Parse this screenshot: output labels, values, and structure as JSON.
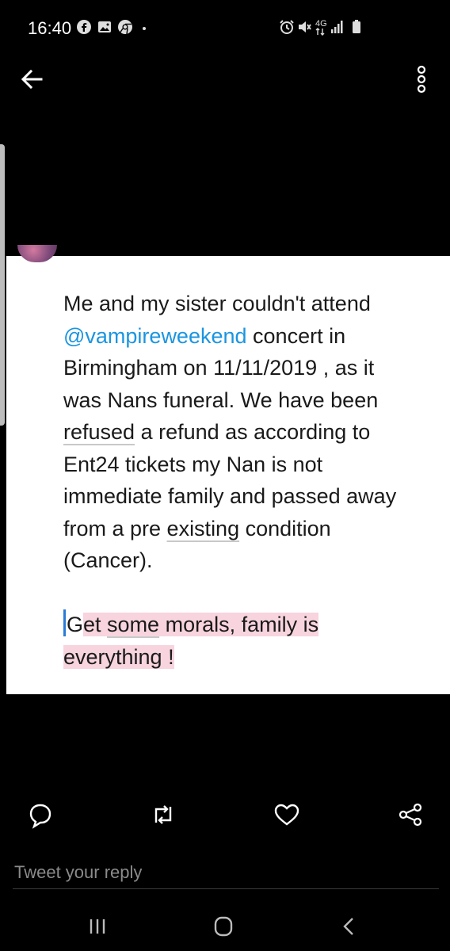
{
  "status_bar": {
    "time": "16:40",
    "network": "4G",
    "left_icons": [
      "facebook-icon",
      "gallery-icon",
      "chrome-icon"
    ],
    "right_icons": [
      "alarm-icon",
      "mute-icon",
      "4g-icon",
      "signal-icon",
      "battery-icon"
    ]
  },
  "top_bar": {
    "back_icon": "arrow-left-icon",
    "menu_icon": "more-vertical-icon"
  },
  "tweet": {
    "line1": "Me and my sister couldn't attend",
    "mention": "@vampireweekend",
    "line2_rest": " concert in",
    "line3": "Birmingham on 11/11/2019 , as it",
    "line4": "was Nans funeral. We have been",
    "word_refused": "refused",
    "line5_rest": " a refund as according to",
    "line6": "Ent24 tickets my Nan is not",
    "line7": "immediate family and passed away",
    "line8_start": "from a pre ",
    "word_existing": "existing",
    "line8_end": " condition",
    "line9": "(Cancer).",
    "hl_G": "G",
    "hl_et": "et ",
    "word_some": "some",
    "hl_rest": " morals, family is",
    "hl_line2": "everything !"
  },
  "actions": {
    "reply_icon": "reply-icon",
    "retweet_icon": "retweet-icon",
    "like_icon": "heart-icon",
    "share_icon": "share-icon"
  },
  "reply": {
    "placeholder": "Tweet your reply"
  },
  "nav_bar": {
    "recents_icon": "recents-icon",
    "home_icon": "home-icon",
    "back_icon": "back-chevron-icon"
  },
  "colors": {
    "mention": "#1b95e0",
    "highlight": "#f7d4de",
    "cursor": "#2a7bd6",
    "background": "#000000",
    "card": "#ffffff"
  }
}
